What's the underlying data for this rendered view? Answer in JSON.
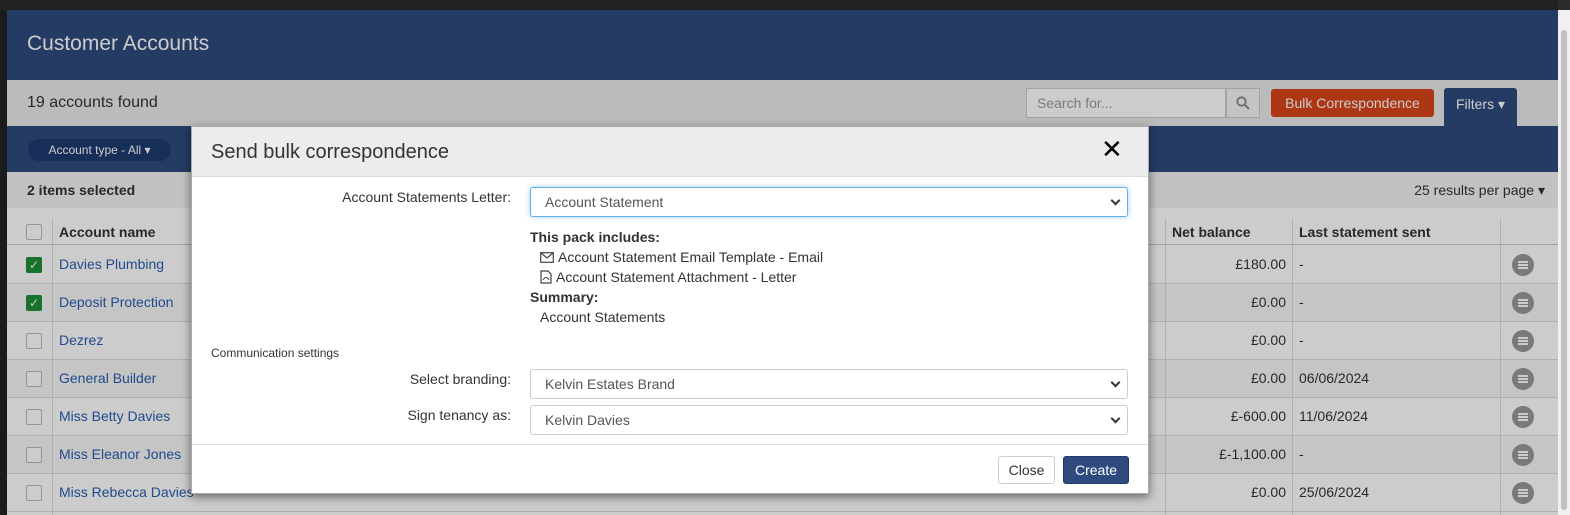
{
  "header": {
    "title": "Customer Accounts"
  },
  "toolbar": {
    "count_text": "19 accounts found",
    "search_placeholder": "Search for...",
    "bulk_label": "Bulk Correspondence",
    "filters_label": "Filters ▾"
  },
  "filters": {
    "account_type_label": "Account type - All ▾"
  },
  "selection": {
    "selected_text": "2 items selected",
    "per_page_label": "25 results per page ▾"
  },
  "table": {
    "columns": {
      "account_name": "Account name",
      "net_balance": "Net balance",
      "last_statement": "Last statement sent"
    },
    "rows": [
      {
        "name": "Davies Plumbing",
        "checked": true,
        "net": "£180.00",
        "last": "-"
      },
      {
        "name": "Deposit Protection",
        "checked": true,
        "net": "£0.00",
        "last": "-"
      },
      {
        "name": "Dezrez",
        "checked": false,
        "net": "£0.00",
        "last": "-"
      },
      {
        "name": "General Builder",
        "checked": false,
        "net": "£0.00",
        "last": "06/06/2024"
      },
      {
        "name": "Miss Betty Davies",
        "checked": false,
        "net": "£-600.00",
        "last": "11/06/2024"
      },
      {
        "name": "Miss Eleanor Jones",
        "checked": false,
        "net": "£-1,100.00",
        "last": "-"
      },
      {
        "name": "Miss Rebecca Davies",
        "checked": false,
        "net": "£0.00",
        "last": "25/06/2024"
      }
    ]
  },
  "modal": {
    "title": "Send bulk correspondence",
    "close_symbol": "✕",
    "letter_label": "Account Statements Letter:",
    "letter_value": "Account Statement",
    "pack_heading": "This pack includes:",
    "pack_items": [
      {
        "icon": "envelope-icon",
        "text": "Account Statement Email Template - Email"
      },
      {
        "icon": "pdf-file-icon",
        "text": "Account Statement Attachment - Letter"
      }
    ],
    "summary_heading": "Summary:",
    "summary_text": "Account Statements",
    "comm_heading": "Communication settings",
    "branding_label": "Select branding:",
    "branding_value": "Kelvin Estates Brand",
    "sign_label": "Sign tenancy as:",
    "sign_value": "Kelvin Davies",
    "close_button": "Close",
    "create_button": "Create"
  },
  "colors": {
    "brand": "#2e4a7e",
    "accent": "#d9441a",
    "check": "#1f8f3a"
  }
}
